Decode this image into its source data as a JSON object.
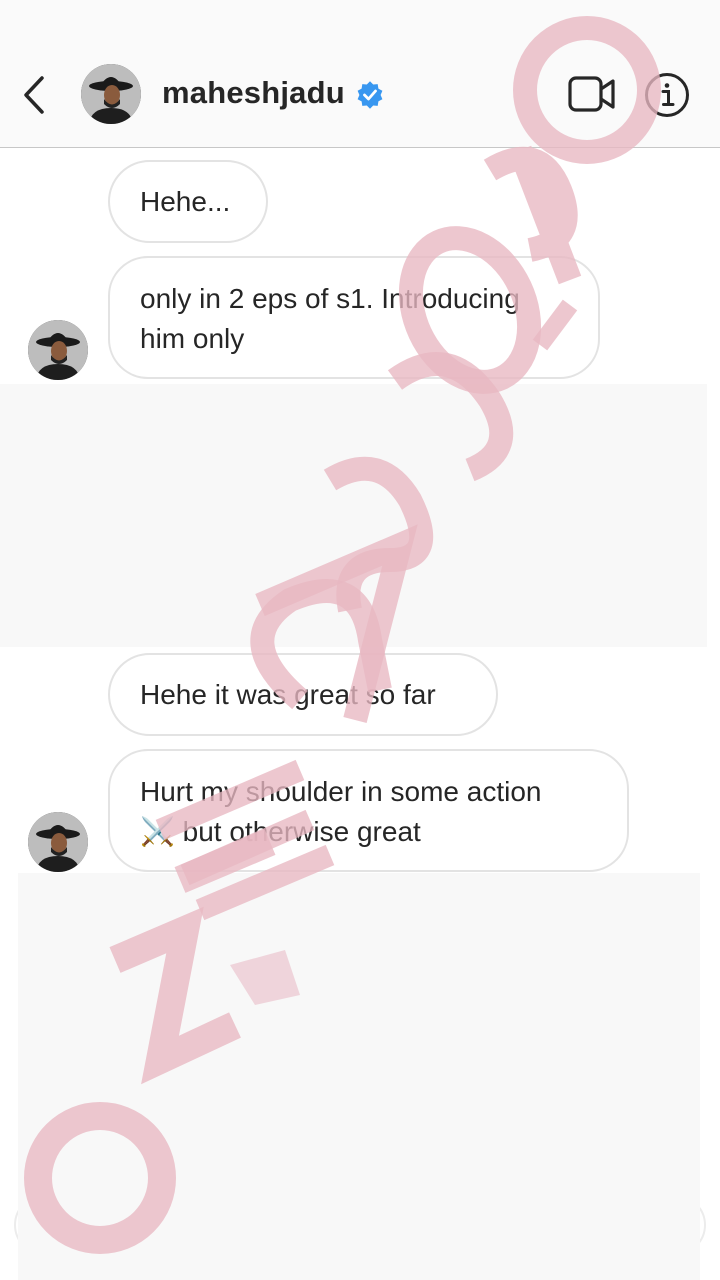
{
  "header": {
    "username": "maheshjadu",
    "verified": true,
    "back_icon": "chevron-left-icon",
    "video_icon": "video-camera-icon",
    "info_icon": "info-icon"
  },
  "messages": [
    {
      "text": "Hehe..."
    },
    {
      "line1": "only in 2 eps of s1. Introducing",
      "line2": "him only"
    },
    {
      "text": "Hehe it was great so far"
    },
    {
      "line1": "Hurt my shoulder in some action",
      "emoji": "⚔️",
      "line2_text": " but otherwise great"
    }
  ],
  "watermark": {
    "text": "MEGASCÓPIO"
  },
  "colors": {
    "accent_verified": "#3897f0",
    "watermark": "#e8b7c2",
    "bubble_border": "#e3e3e3"
  }
}
